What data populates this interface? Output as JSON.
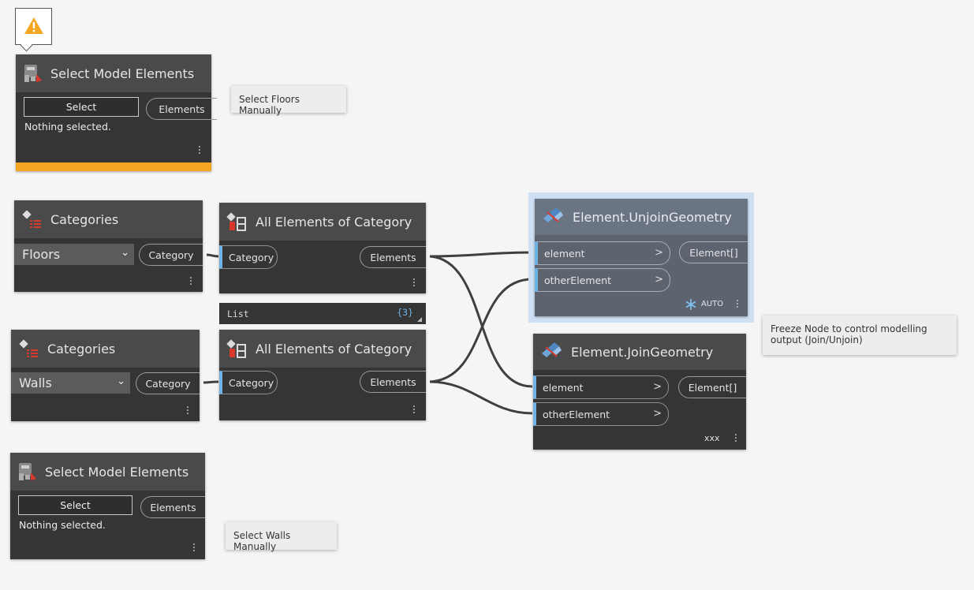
{
  "warning": {
    "icon": "warning-icon"
  },
  "select_floors": {
    "title": "Select Model Elements",
    "select_label": "Select",
    "output_label": "Elements",
    "status": "Nothing selected.",
    "state_color": "#f5a623"
  },
  "note_floors": "Select Floors Manually",
  "categories_floors": {
    "title": "Categories",
    "selected": "Floors",
    "output_label": "Category"
  },
  "aeoc_floors": {
    "title": "All Elements of Category",
    "input_label": "Category",
    "output_label": "Elements"
  },
  "watch": {
    "label": "List",
    "count": "{3}"
  },
  "categories_walls": {
    "title": "Categories",
    "selected": "Walls",
    "output_label": "Category"
  },
  "aeoc_walls": {
    "title": "All Elements of Category",
    "input_label": "Category",
    "output_label": "Elements"
  },
  "unjoin": {
    "title": "Element.UnjoinGeometry",
    "input1": "element",
    "input2": "otherElement",
    "output_label": "Element[]",
    "lacing": "AUTO",
    "frozen_icon": "snowflake-icon",
    "highlight_color": "#cfe0f5"
  },
  "join": {
    "title": "Element.JoinGeometry",
    "input1": "element",
    "input2": "otherElement",
    "output_label": "Element[]",
    "lacing": "xxx"
  },
  "note_freeze": "Freeze Node to control modelling output (Join/Unjoin)",
  "select_walls": {
    "title": "Select Model Elements",
    "select_label": "Select",
    "output_label": "Elements",
    "status": "Nothing selected."
  },
  "note_walls": "Select Walls Manually",
  "port_arrow": ">"
}
